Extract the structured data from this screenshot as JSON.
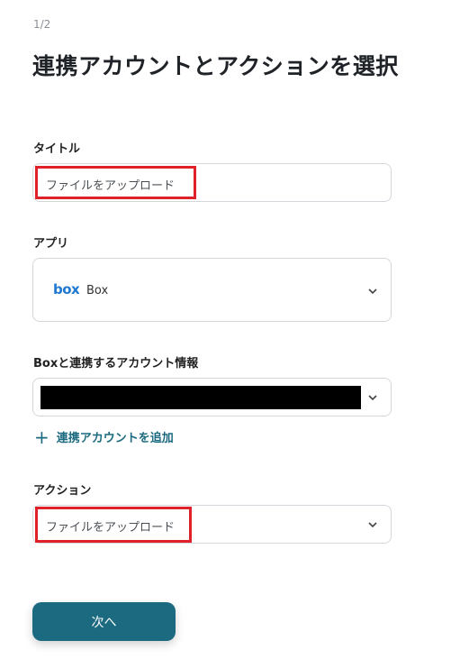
{
  "step_indicator": "1/2",
  "page_title": "連携アカウントとアクションを選択",
  "title_field": {
    "label": "タイトル",
    "value": "ファイルをアップロード"
  },
  "app_field": {
    "label": "アプリ",
    "logo_text": "box",
    "selected": "Box"
  },
  "account_field": {
    "label": "Boxと連携するアカウント情報"
  },
  "add_account": {
    "icon": "plus-icon",
    "label": "連携アカウントを追加"
  },
  "action_field": {
    "label": "アクション",
    "selected": "ファイルをアップロード"
  },
  "next_button": {
    "label": "次へ"
  },
  "colors": {
    "accent": "#1b6a80",
    "highlight": "#e0212a",
    "box_brand": "#1f78d1"
  }
}
